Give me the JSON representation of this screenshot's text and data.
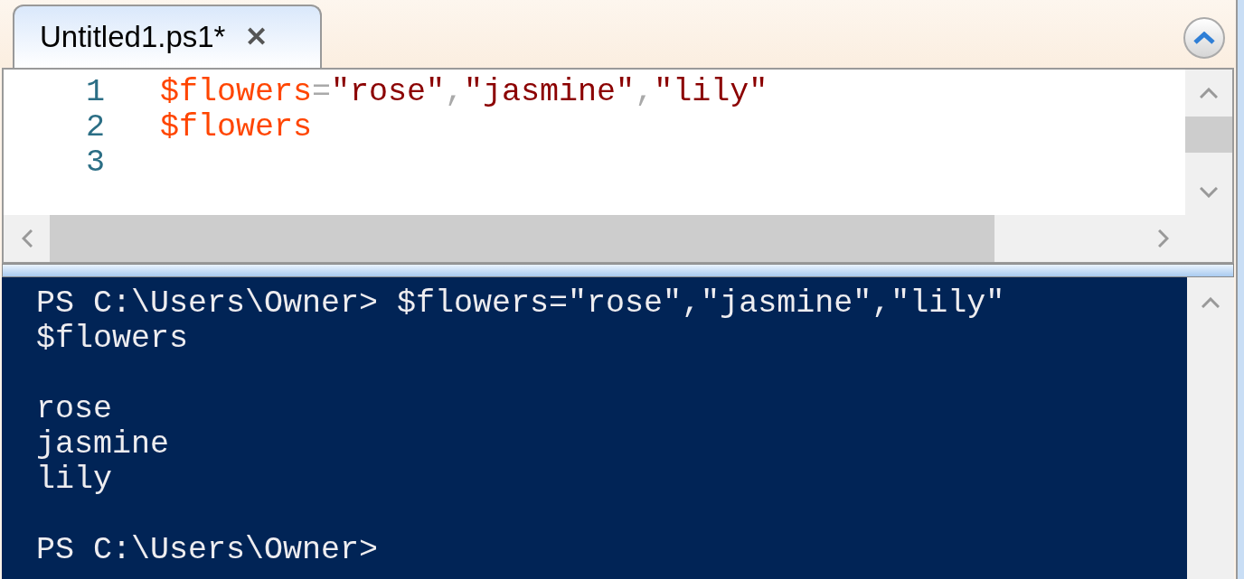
{
  "tab": {
    "title": "Untitled1.ps1*",
    "close": "✕",
    "selected": true
  },
  "editor": {
    "lines": [
      {
        "number": "1",
        "tokens": [
          {
            "kind": "variable",
            "text": "$flowers"
          },
          {
            "kind": "operator",
            "text": "="
          },
          {
            "kind": "string",
            "text": "\"rose\""
          },
          {
            "kind": "operator",
            "text": ","
          },
          {
            "kind": "string",
            "text": "\"jasmine\""
          },
          {
            "kind": "operator",
            "text": ","
          },
          {
            "kind": "string",
            "text": "\"lily\""
          }
        ]
      },
      {
        "number": "2",
        "tokens": [
          {
            "kind": "variable",
            "text": "$flowers"
          }
        ]
      },
      {
        "number": "3"
      }
    ]
  },
  "console": {
    "blocks": [
      [
        "PS C:\\Users\\Owner> $flowers=\"rose\",\"jasmine\",\"lily\"",
        "$flowers"
      ],
      [
        "rose",
        "jasmine",
        "lily"
      ],
      [
        "PS C:\\Users\\Owner>"
      ]
    ]
  }
}
